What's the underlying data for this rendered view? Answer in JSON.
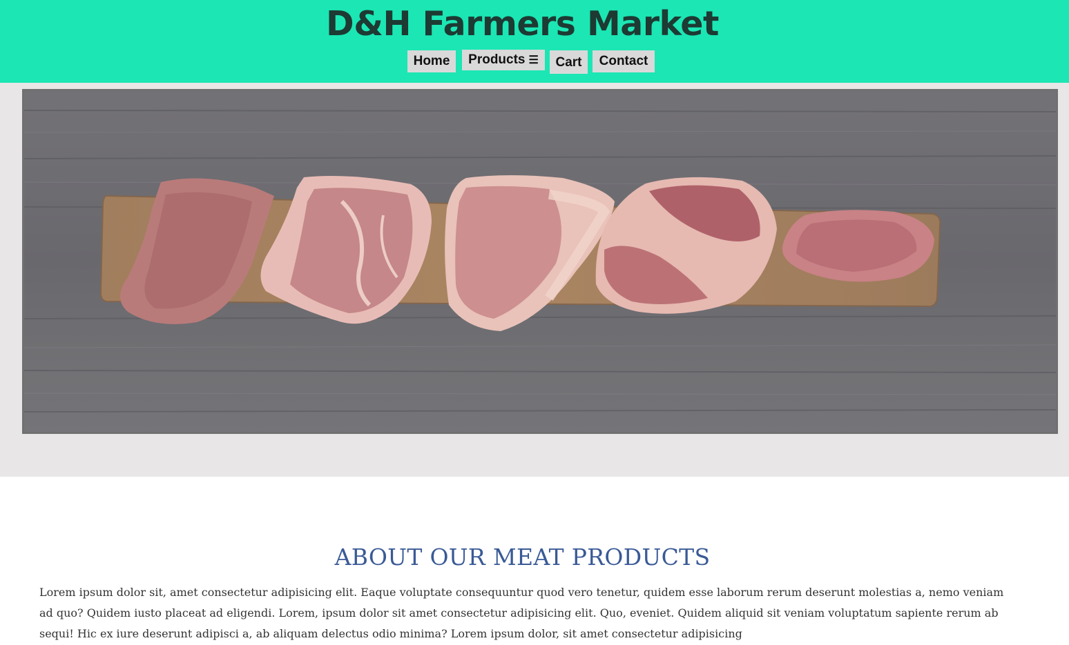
{
  "header": {
    "title": "D&H Farmers Market",
    "nav": [
      {
        "label": "Home"
      },
      {
        "label": "Products",
        "icon": "menu-icon"
      },
      {
        "label": "Cart"
      },
      {
        "label": "Contact"
      }
    ]
  },
  "hero": {
    "image": "raw-meat-steaks-on-cutting-board"
  },
  "about": {
    "title": "ABOUT OUR MEAT PRODUCTS",
    "text": "Lorem ipsum dolor sit, amet consectetur adipisicing elit. Eaque voluptate consequuntur quod vero tenetur, quidem esse laborum rerum deserunt molestias a, nemo veniam ad quo? Quidem iusto placeat ad eligendi. Lorem, ipsum dolor sit amet consectetur adipisicing elit. Quo, eveniet. Quidem aliquid sit veniam voluptatum sapiente rerum ab sequi! Hic ex iure deserunt adipisci a, ab aliquam delectus odio minima? Lorem ipsum dolor, sit amet consectetur adipisicing"
  },
  "colors": {
    "header_bg": "#1be6b4",
    "hero_band_bg": "#e8e6e7",
    "about_title": "#3a5a96"
  }
}
